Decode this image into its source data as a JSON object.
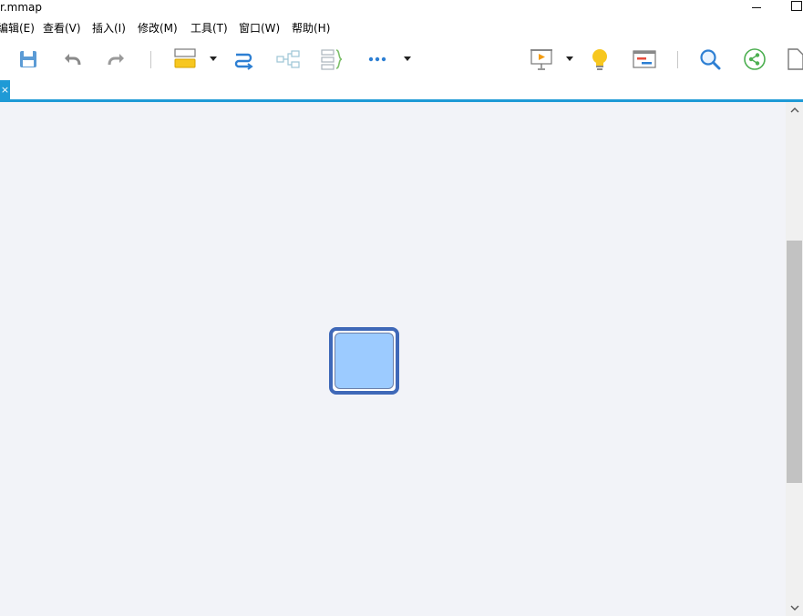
{
  "window": {
    "title": "r.mmap",
    "controls": {
      "minimize_icon": "minimize-icon",
      "maximize_icon": "maximize-icon"
    }
  },
  "menubar": {
    "items": [
      {
        "label": "编辑(E)"
      },
      {
        "label": "查看(V)"
      },
      {
        "label": "插入(I)"
      },
      {
        "label": "修改(M)"
      },
      {
        "label": "工具(T)"
      },
      {
        "label": "窗口(W)"
      },
      {
        "label": "帮助(H)"
      }
    ]
  },
  "toolbar": {
    "buttons": [
      {
        "name": "save",
        "icon": "save-icon"
      },
      {
        "name": "undo",
        "icon": "undo-icon"
      },
      {
        "name": "redo",
        "icon": "redo-icon"
      },
      {
        "name": "insert-topic",
        "icon": "insert-topic-icon"
      },
      {
        "name": "relationship",
        "icon": "relationship-icon"
      },
      {
        "name": "layout",
        "icon": "layout-icon"
      },
      {
        "name": "boundary",
        "icon": "boundary-icon"
      },
      {
        "name": "more",
        "icon": "more-icon"
      },
      {
        "name": "presentation",
        "icon": "presentation-icon"
      },
      {
        "name": "idea",
        "icon": "lightbulb-icon"
      },
      {
        "name": "gantt",
        "icon": "gantt-icon"
      },
      {
        "name": "search",
        "icon": "search-icon"
      },
      {
        "name": "share",
        "icon": "share-icon"
      },
      {
        "name": "document",
        "icon": "document-icon"
      }
    ]
  },
  "document_tab": {
    "close_glyph": "×"
  },
  "canvas": {
    "background": "#f2f3f8",
    "node": {
      "text": "",
      "border_color": "#3f68b8",
      "fill_color": "#9ccbff"
    }
  },
  "colors": {
    "accent": "#1e9ad6"
  }
}
